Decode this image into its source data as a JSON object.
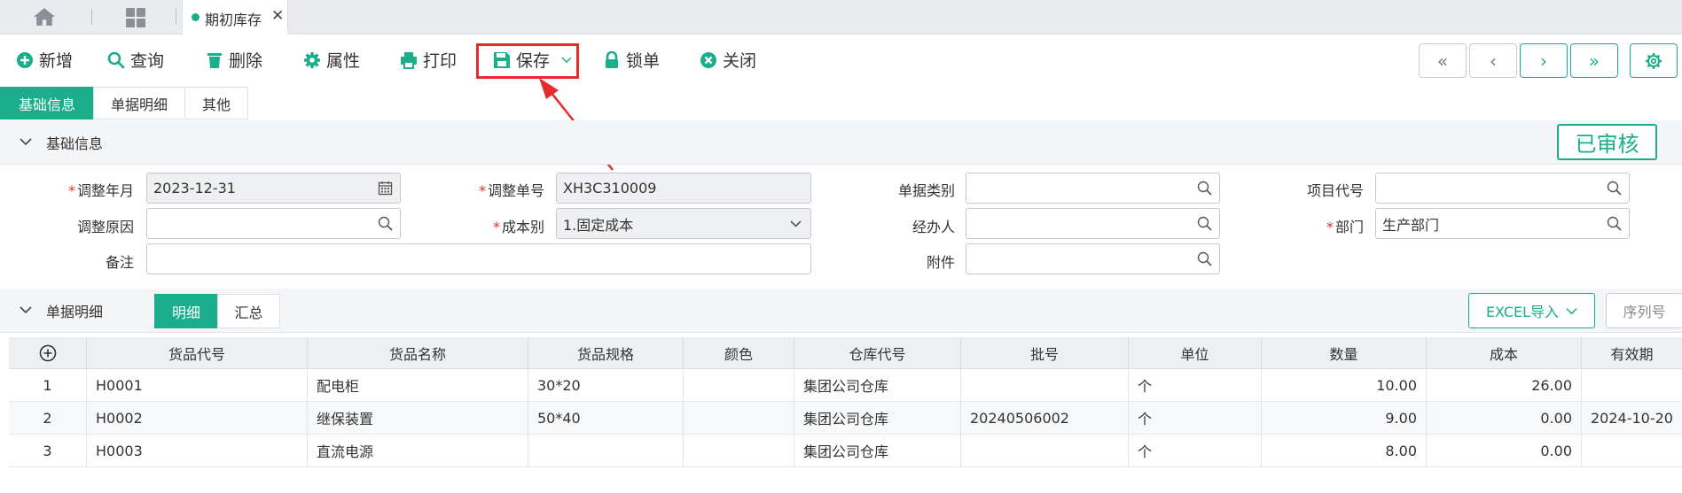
{
  "tabs": {
    "active_label": "期初库存",
    "close": "✕"
  },
  "toolbar": {
    "add": "新增",
    "query": "查询",
    "delete": "删除",
    "properties": "属性",
    "print": "打印",
    "save": "保存",
    "lock": "锁单",
    "close": "关闭",
    "nav_first": "«",
    "nav_prev": "‹",
    "nav_next": "›",
    "nav_last": "»"
  },
  "subtabs": [
    "基础信息",
    "单据明细",
    "其他"
  ],
  "basic_section": {
    "title": "基础信息",
    "status": "已审核"
  },
  "form": {
    "adjust_month_label": "调整年月",
    "adjust_month": "2023-12-31",
    "adjust_no_label": "调整单号",
    "adjust_no": "XH3C310009",
    "doc_type_label": "单据类别",
    "doc_type": "",
    "project_code_label": "项目代号",
    "project_code": "",
    "reason_label": "调整原因",
    "reason": "",
    "cost_type_label": "成本别",
    "cost_type": "1.固定成本",
    "handler_label": "经办人",
    "handler": "",
    "dept_label": "部门",
    "dept": "生产部门",
    "remark_label": "备注",
    "remark": "",
    "attachment_label": "附件",
    "attachment": ""
  },
  "detail_section": {
    "title": "单据明细",
    "tab_detail": "明细",
    "tab_summary": "汇总",
    "excel_import": "EXCEL导入",
    "serial": "序列号"
  },
  "table": {
    "headers": [
      "货品代号",
      "货品名称",
      "货品规格",
      "颜色",
      "仓库代号",
      "批号",
      "单位",
      "数量",
      "成本",
      "有效期"
    ],
    "rows": [
      [
        "1",
        "H0001",
        "配电柜",
        "30*20",
        "",
        "集团公司仓库",
        "",
        "个",
        "10.00",
        "26.00",
        ""
      ],
      [
        "2",
        "H0002",
        "继保装置",
        "50*40",
        "",
        "集团公司仓库",
        "20240506002",
        "个",
        "9.00",
        "0.00",
        "2024-10-20"
      ],
      [
        "3",
        "H0003",
        "直流电源",
        "",
        "",
        "集团公司仓库",
        "",
        "个",
        "8.00",
        "0.00",
        ""
      ]
    ]
  },
  "colors": {
    "accent": "#1aae8a",
    "highlight": "#e52b2b"
  }
}
